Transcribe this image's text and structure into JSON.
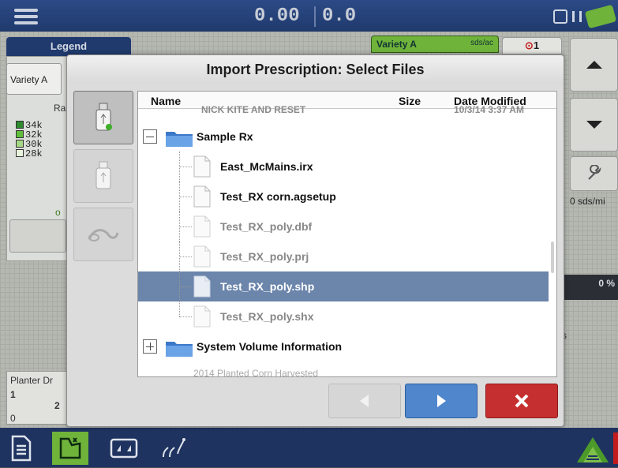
{
  "topbar": {
    "readout_left": "0.00",
    "readout_right": "0.0",
    "menu_icon": "hamburger-menu-icon",
    "gps_icon": "gps-status-icon",
    "satellite_icon": "satellite-icon"
  },
  "background": {
    "legend_title": "Legend",
    "legend_variety": "Variety A",
    "legend_rate_label": "Ra",
    "legend_items": [
      {
        "label": "34k",
        "color": "#2e8b2e"
      },
      {
        "label": "32k",
        "color": "#5fbf3c"
      },
      {
        "label": "30k",
        "color": "#a6d985"
      },
      {
        "label": "28k",
        "color": "#e8f5dc"
      }
    ],
    "legend_footer": "o",
    "variety_tab_label": "Variety A",
    "variety_tab_unit": "sds/ac",
    "count_tab_value": "1",
    "rate_text": "0 sds/mi",
    "progress_text": "0 %",
    "progress_fraction": 0.0,
    "s_text": "s",
    "planter_label": "Planter Dr",
    "planter_row1_a": "1",
    "planter_row1_b": "2",
    "planter_row2": "0"
  },
  "dialog": {
    "title": "Import Prescription: Select Files",
    "devices": [
      {
        "name": "usb-drive-connected-icon",
        "state": "selected"
      },
      {
        "name": "usb-drive-icon",
        "state": "disabled"
      },
      {
        "name": "network-icon",
        "state": "disabled"
      }
    ],
    "columns": {
      "name": "Name",
      "size": "Size",
      "date_modified": "Date Modified"
    },
    "ghost_top_name": "NICK KITE AND RESET",
    "ghost_top_date": "10/3/14 3:37 AM",
    "folders": [
      {
        "name": "Sample Rx",
        "expanded": true
      }
    ],
    "files": [
      {
        "name": "East_McMains.irx",
        "dim": false,
        "selected": false
      },
      {
        "name": "Test_RX corn.agsetup",
        "dim": false,
        "selected": false
      },
      {
        "name": "Test_RX_poly.dbf",
        "dim": true,
        "selected": false
      },
      {
        "name": "Test_RX_poly.prj",
        "dim": true,
        "selected": false
      },
      {
        "name": "Test_RX_poly.shp",
        "dim": false,
        "selected": true
      },
      {
        "name": "Test_RX_poly.shx",
        "dim": true,
        "selected": false
      }
    ],
    "bottom_folder": {
      "name": "System Volume Information",
      "expanded": false
    },
    "ghost_bottom": "2014 Planted Corn Harvested",
    "buttons": {
      "prev_icon": "arrow-left-icon",
      "next_icon": "arrow-right-icon",
      "cancel_icon": "close-icon"
    }
  },
  "bottombar": {
    "items": [
      {
        "name": "document-icon",
        "active": false
      },
      {
        "name": "field-map-icon",
        "active": true
      },
      {
        "name": "split-view-icon",
        "active": false
      },
      {
        "name": "crop-plants-icon",
        "active": false
      }
    ],
    "brand_icon": "brand-logo-icon"
  }
}
